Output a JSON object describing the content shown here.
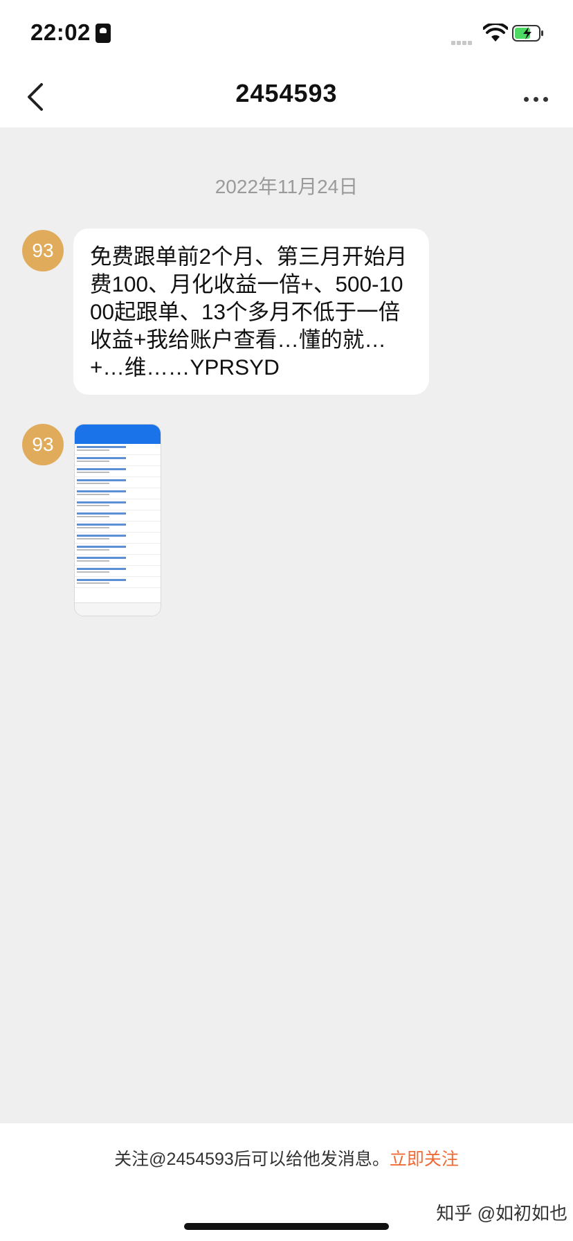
{
  "status_bar": {
    "time": "22:02"
  },
  "header": {
    "title": "2454593"
  },
  "chat": {
    "date": "2022年11月24日",
    "messages": [
      {
        "avatar_text": "93",
        "text": "免费跟单前2个月、第三月开始月费100、月化收益一倍+、500-1000起跟单、13个多月不低于一倍收益+我给账户查看…懂的就…+…维……YPRSYD"
      },
      {
        "avatar_text": "93",
        "type": "image"
      }
    ]
  },
  "footer": {
    "follow_text": "关注@2454593后可以给他发消息。",
    "follow_link": "立即关注"
  },
  "watermark": "知乎 @如初如也",
  "colors": {
    "avatar": "#e0ac5c",
    "link": "#f06a35",
    "background": "#efefef"
  },
  "icons": [
    "back-icon",
    "more-icon",
    "wifi-icon",
    "battery-icon",
    "sim-icon"
  ]
}
